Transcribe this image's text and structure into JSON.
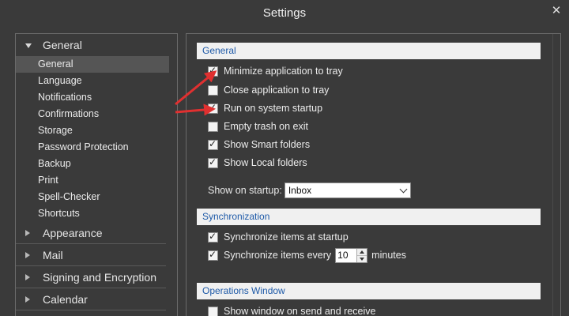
{
  "window": {
    "title": "Settings",
    "close_glyph": "✕"
  },
  "nav": {
    "groups": [
      {
        "label": "General",
        "expanded": true
      },
      {
        "label": "Appearance",
        "expanded": false
      },
      {
        "label": "Mail",
        "expanded": false
      },
      {
        "label": "Signing and Encryption",
        "expanded": false
      },
      {
        "label": "Calendar",
        "expanded": false
      }
    ],
    "general_items": [
      "General",
      "Language",
      "Notifications",
      "Confirmations",
      "Storage",
      "Password Protection",
      "Backup",
      "Print",
      "Spell-Checker",
      "Shortcuts"
    ],
    "selected_item": "General"
  },
  "sections": {
    "general": {
      "title": "General",
      "options": [
        {
          "label": "Minimize application to tray",
          "checked": true
        },
        {
          "label": "Close application to tray",
          "checked": false
        },
        {
          "label": "Run on system startup",
          "checked": true
        },
        {
          "label": "Empty trash on exit",
          "checked": false
        },
        {
          "label": "Show Smart folders",
          "checked": true
        },
        {
          "label": "Show Local folders",
          "checked": true
        }
      ],
      "startup_label": "Show on startup:",
      "startup_value": "Inbox"
    },
    "sync": {
      "title": "Synchronization",
      "opt1": {
        "label": "Synchronize items at startup",
        "checked": true
      },
      "opt2": {
        "label_before": "Synchronize items every",
        "value": "10",
        "label_after": "minutes",
        "checked": true
      }
    },
    "ops": {
      "title": "Operations Window",
      "opt1": {
        "label": "Show window on send and receive",
        "checked": false
      }
    }
  },
  "colors": {
    "background": "#3a3a3a",
    "section_header_text": "#1e5aa8",
    "annotation_arrow": "#e03030"
  }
}
